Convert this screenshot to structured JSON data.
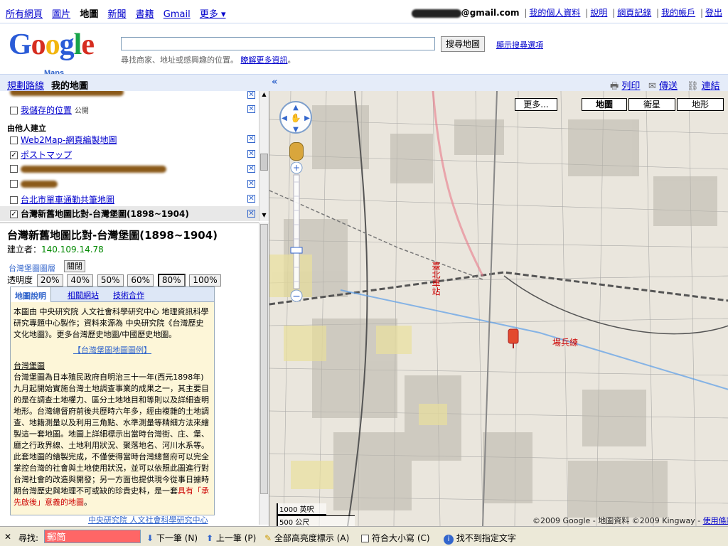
{
  "topbar": {
    "nav": [
      "所有網頁",
      "圖片",
      "地圖",
      "新聞",
      "書籍",
      "Gmail",
      "更多 ▾"
    ],
    "current": "地圖",
    "email_suffix": "@gmail.com",
    "account_links": [
      "我的個人資料",
      "說明",
      "網頁記錄",
      "我的帳戶",
      "登出"
    ]
  },
  "header": {
    "logo": "Google",
    "logo_sub": "Maps",
    "search_value": "",
    "search_button": "搜尋地圖",
    "show_options": "顯示搜尋選項",
    "hint": "尋找商家、地址或感興趣的位置。",
    "hint_link": "瞭解更多資訊"
  },
  "panel": {
    "tab_routes": "規劃路線",
    "tab_mymaps": "我的地圖",
    "saved_places": "我儲存的位置",
    "public_label": "公開",
    "others_title": "由他人建立",
    "others": [
      {
        "label": "Web2Map-網頁編製地圖",
        "checked": false
      },
      {
        "label": "ポストマップ",
        "checked": true
      },
      {
        "label": "",
        "checked": false
      },
      {
        "label": "",
        "checked": false
      },
      {
        "label": "台北市單車通勤共筆地圖",
        "checked": false
      },
      {
        "label": "台灣新舊地圖比對-台灣堡圖(1898~1904)",
        "checked": true
      }
    ]
  },
  "maphead": {
    "collapse": "«",
    "print": "列印",
    "send": "傳送",
    "link": "連結"
  },
  "detail": {
    "title": "台灣新舊地圖比對-台灣堡圖(1898~1904)",
    "creator_label": "建立者：",
    "creator_ip": "140.109.14.78",
    "layer_label": "台灣堡圖圖層",
    "close_button": "關閉",
    "opacity_label": "透明度",
    "opacity_options": [
      "20%",
      "40%",
      "50%",
      "60%",
      "80%",
      "100%"
    ],
    "opacity_selected": "80%",
    "tabs": [
      "地圖說明",
      "相關網站",
      "技術合作"
    ],
    "para1": "本圖由 中央研究院 人文社會科學研究中心 地理資訊科學研究專題中心製作；資料來源為 中央研究院《台灣歷史文化地圖》。更多台灣歷史地圖/中國歷史地圖。",
    "legend_link": "【台灣堡圖地圖圖例】",
    "section_title": "台灣堡圖",
    "para2": "台灣堡圖為日本殖民政府自明治三十一年(西元1898年)九月起開始實施台灣土地調查事業的成果之一，其主要目的是在調查土地權力、區分土地地目和等則以及詳細查明地形。台灣總督府前後共歷時六年多，經由複雜的土地調查、地籍測量以及利用三角點、水準測量等精細方法來繪製這一套地圖。地圖上詳細標示出當時台灣街、庄、堡、廳之行政界線、土地利用狀況、聚落地名、河川水系等。此套地圖的繪製完成，不僅使得當時台灣總督府可以完全掌控台灣的社會與土地使用狀況，並可以依照此圖進行對台灣社會的改造與開發；另一方面也提供現今從事日據時期台灣歷史與地理不可或缺的珍貴史料，是一套",
    "para2_red": "具有「承先啟後」意義的地圖",
    "para2_end": "。",
    "footer_link": "中央研究院 人文社會科學研究中心"
  },
  "map": {
    "more": "更多...",
    "types": [
      "地圖",
      "衛星",
      "地形"
    ],
    "selected_type": "地圖",
    "label_station": "臺北車站",
    "label_field": "場兵練",
    "scale_top": "1000 英呎",
    "scale_bottom": "500 公尺",
    "attribution": "©2009 Google - 地圖資料 ©2009 Kingway - ",
    "terms": "使用條款"
  },
  "findbar": {
    "find_label": "尋找:",
    "find_value": "郵筒",
    "next": "下一筆 (N)",
    "prev": "上一筆 (P)",
    "highlight": "全部高亮度標示 (A)",
    "matchcase": "符合大小寫 (C)",
    "status": "找不到指定文字"
  },
  "colors": {
    "link": "#0000cc",
    "accent_bg": "#e5ecf9",
    "find_red": "#ff6666",
    "pin": "#e34a2f"
  }
}
